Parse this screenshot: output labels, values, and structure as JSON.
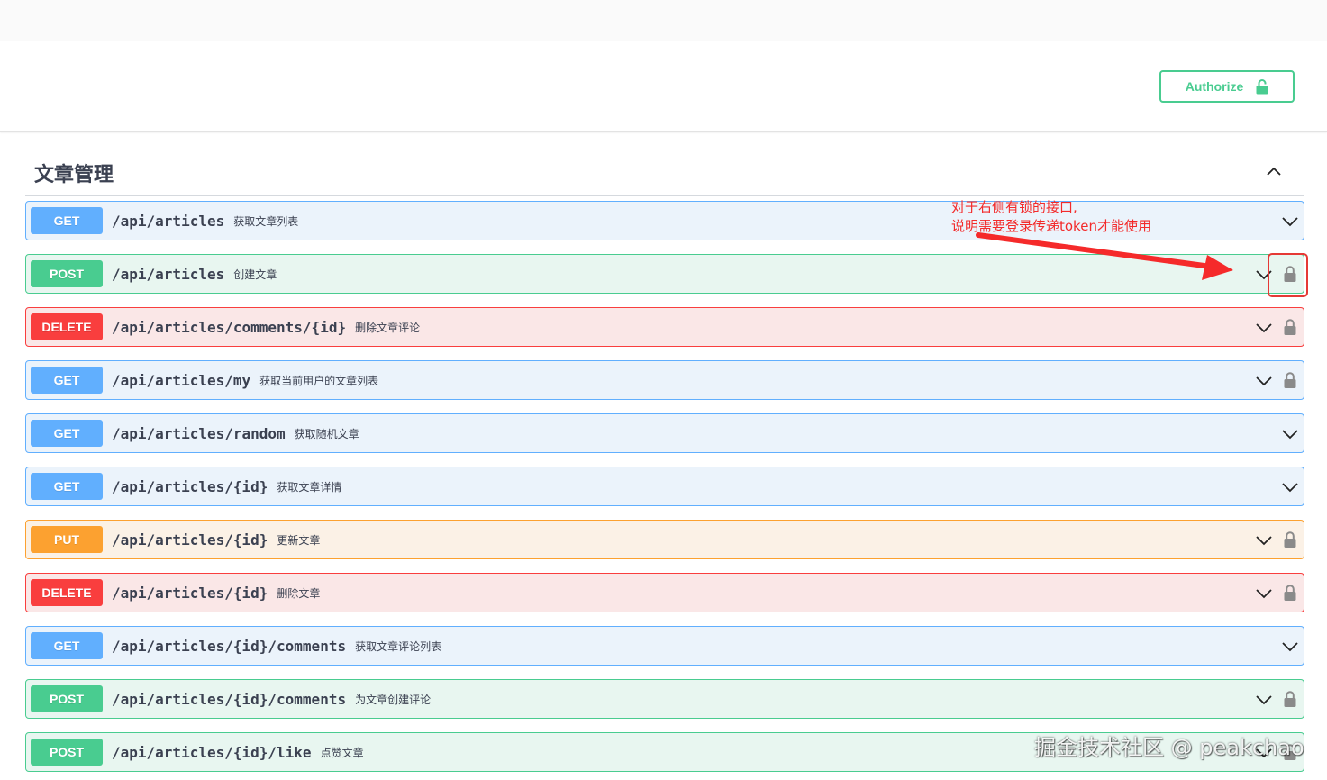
{
  "authorize": {
    "label": "Authorize",
    "icon": "lock-icon",
    "color": "#49cc90"
  },
  "tag": {
    "title": "文章管理",
    "toggle_icon": "chevron-up-icon"
  },
  "method_colors": {
    "GET": "#61affe",
    "POST": "#49cc90",
    "DELETE": "#f93e3e",
    "PUT": "#fca130"
  },
  "operations": [
    {
      "method": "GET",
      "path": "/api/articles",
      "summary": "获取文章列表",
      "locked": false
    },
    {
      "method": "POST",
      "path": "/api/articles",
      "summary": "创建文章",
      "locked": true
    },
    {
      "method": "DELETE",
      "path": "/api/articles/comments/{id}",
      "summary": "删除文章评论",
      "locked": true
    },
    {
      "method": "GET",
      "path": "/api/articles/my",
      "summary": "获取当前用户的文章列表",
      "locked": true
    },
    {
      "method": "GET",
      "path": "/api/articles/random",
      "summary": "获取随机文章",
      "locked": false
    },
    {
      "method": "GET",
      "path": "/api/articles/{id}",
      "summary": "获取文章详情",
      "locked": false
    },
    {
      "method": "PUT",
      "path": "/api/articles/{id}",
      "summary": "更新文章",
      "locked": true
    },
    {
      "method": "DELETE",
      "path": "/api/articles/{id}",
      "summary": "删除文章",
      "locked": true
    },
    {
      "method": "GET",
      "path": "/api/articles/{id}/comments",
      "summary": "获取文章评论列表",
      "locked": false
    },
    {
      "method": "POST",
      "path": "/api/articles/{id}/comments",
      "summary": "为文章创建评论",
      "locked": true
    },
    {
      "method": "POST",
      "path": "/api/articles/{id}/like",
      "summary": "点赞文章",
      "locked": true
    }
  ],
  "annotation": {
    "line1": "对于右侧有锁的接口,",
    "line2": "说明需要登录传递token才能使用",
    "color": "#f32b2b"
  },
  "watermark": "掘金技术社区 @ peakchao"
}
